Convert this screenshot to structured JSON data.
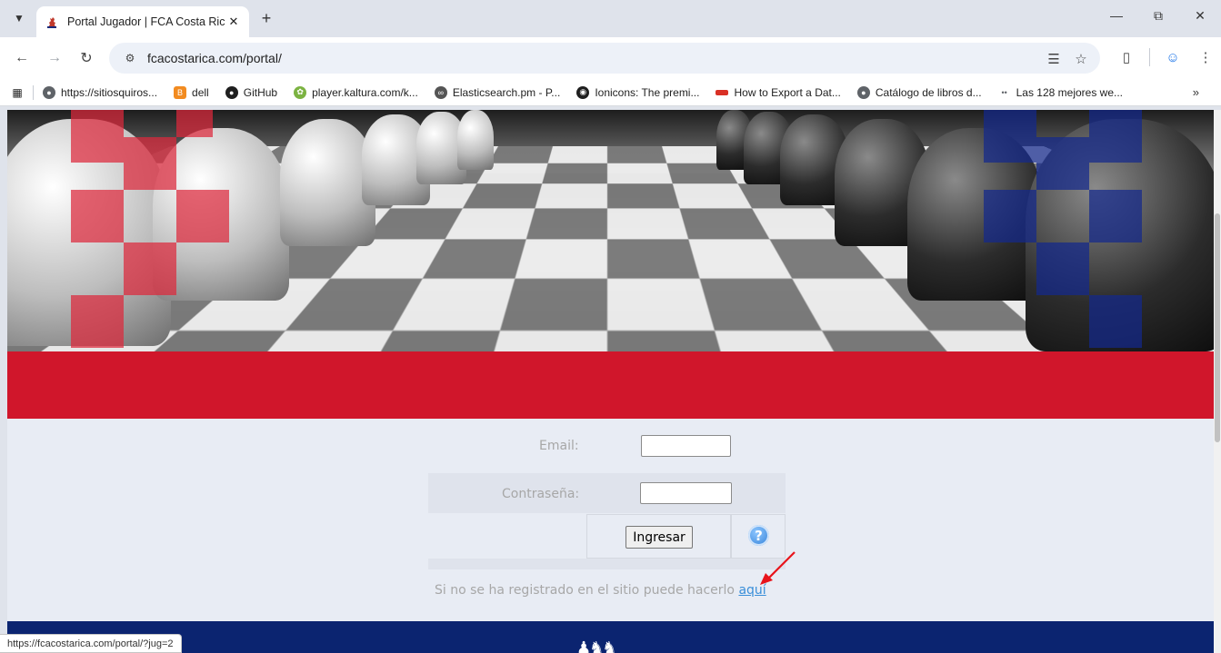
{
  "browser": {
    "tab_title": "Portal Jugador | FCA Costa Rica",
    "url": "fcacostarica.com/portal/",
    "status_url": "https://fcacostarica.com/portal/?jug=2",
    "bookmarks": [
      {
        "label": "https://sitiosquiros...",
        "icon": "globe-icon",
        "color": "#5f6368"
      },
      {
        "label": "dell",
        "icon": "blogger-icon",
        "color": "#f28b20"
      },
      {
        "label": "GitHub",
        "icon": "github-icon",
        "color": "#1f1f1f"
      },
      {
        "label": "player.kaltura.com/k...",
        "icon": "kaltura-icon",
        "color": "#7cb342"
      },
      {
        "label": "Elasticsearch.pm - P...",
        "icon": "elastic-icon",
        "color": "#555555"
      },
      {
        "label": "Ionicons: The premi...",
        "icon": "ionicons-icon",
        "color": "#1f1f1f"
      },
      {
        "label": "How to Export a Dat...",
        "icon": "export-icon",
        "color": "#d93025"
      },
      {
        "label": "Catálogo de libros d...",
        "icon": "globe-icon",
        "color": "#5f6368"
      },
      {
        "label": "Las 128 mejores we...",
        "icon": "bookmark-icon",
        "color": "#5f6368"
      }
    ]
  },
  "form": {
    "email_label": "Email:",
    "email_value": "",
    "password_label": "Contraseña:",
    "password_value": "",
    "submit_label": "Ingresar",
    "help_label": "?",
    "register_text": "Si no se ha registrado en el sitio puede hacerlo ",
    "register_link": "aquí"
  },
  "colors": {
    "red_bar": "#d0162b",
    "footer": "#0b2470",
    "link": "#3a8fd9"
  }
}
